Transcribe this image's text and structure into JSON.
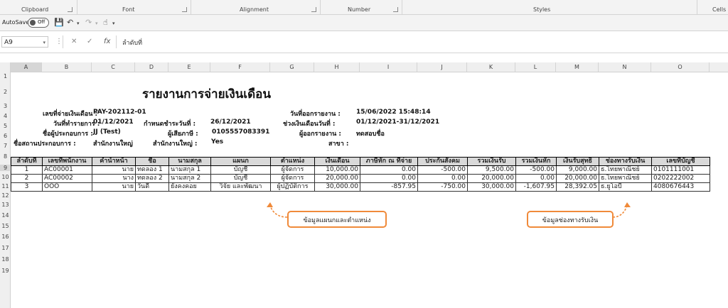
{
  "ribbon": {
    "groups": [
      "Clipboard",
      "Font",
      "Alignment",
      "Number",
      "Styles",
      "Cells"
    ],
    "top_items": [
      "Format Painter",
      "Formatting",
      "Table"
    ]
  },
  "qat": {
    "autosave_label": "AutoSave",
    "autosave_state": "Off"
  },
  "formula_bar": {
    "name_box": "A9",
    "content": "ลำดับที่"
  },
  "columns": [
    "A",
    "B",
    "C",
    "D",
    "E",
    "F",
    "G",
    "H",
    "I",
    "J",
    "K",
    "L",
    "M",
    "N",
    "O"
  ],
  "rows": [
    "1",
    "2",
    "3",
    "4",
    "5",
    "6",
    "7",
    "8",
    "9",
    "10",
    "11",
    "12",
    "13",
    "14",
    "15",
    "16",
    "17",
    "18",
    "19"
  ],
  "report": {
    "title": "รายงานการจ่ายเงินเดือน",
    "pay_no_label": "เลขที่จ่ายเงินเดือน :",
    "pay_no": "PAY-202112-01",
    "issue_date_label": "วันที่ออกรายงาน :",
    "issue_date": "15/06/2022 15:48:14",
    "doc_date_label": "วันที่ทำรายการ :",
    "doc_date": "01/12/2021",
    "due_date_label": "กำหนดชำระวันที่ :",
    "due_date": "26/12/2021",
    "period_label": "ช่วงเงินเดือนวันที่ :",
    "period": "01/12/2021-31/12/2021",
    "company_label": "ชื่อผู้ประกอบการ :",
    "company": "JJ (Test)",
    "taxid_label": "ผู้เสียภาษี :",
    "taxid": "0105557083391",
    "reporter_label": "ผู้ออกรายงาน :",
    "reporter": "ทดสอบชื่อ",
    "branch_name_label": "ชื่อสถานประกอบการ :",
    "branch_name": "สำนักงานใหญ่",
    "head_office_label": "สำนักงานใหญ่ :",
    "head_office": "Yes",
    "branch_label": "สาขา :"
  },
  "table": {
    "headers": [
      "ลำดับที่",
      "เลขที่พนักงาน",
      "คำนำหน้า",
      "ชื่อ",
      "นามสกุล",
      "แผนก",
      "ตำแหน่ง",
      "เงินเดือน",
      "ภาษีหัก ณ ที่จ่าย",
      "ประกันสังคม",
      "รวมเงินรับ",
      "รวมเงินหัก",
      "เงินรับสุทธิ",
      "ช่องทางรับเงิน",
      "เลขที่บัญชี"
    ],
    "rows": [
      [
        "1",
        "AC00001",
        "นาย",
        "ทดลอง 1",
        "นามสกุล 1",
        "บัญชี",
        "ผู้จัดการ",
        "10,000.00",
        "0.00",
        "-500.00",
        "9,500.00",
        "-500.00",
        "9,000.00",
        "ธ.ไทยพาณิชย์",
        "0101111001"
      ],
      [
        "2",
        "AC00002",
        "นาง",
        "ทดลอง 2",
        "นามสกุล 2",
        "บัญชี",
        "ผู้จัดการ",
        "20,000.00",
        "0.00",
        "0.00",
        "20,000.00",
        "0.00",
        "20,000.00",
        "ธ.ไทยพาณิชย์",
        "0202222002"
      ],
      [
        "3",
        "OOO",
        "นาย",
        "วันดี",
        "ยังคงคอย",
        "วิจัย และพัฒนา",
        "ผู้ปฏิบัติการ",
        "30,000.00",
        "-857.95",
        "-750.00",
        "30,000.00",
        "-1,607.95",
        "28,392.05",
        "ธ.ยูโอบี",
        "4080676443"
      ]
    ]
  },
  "callouts": {
    "dept_position": "ข้อมูลแผนกและตำแหน่ง",
    "payment_channel": "ข้อมูลช่องทางรับเงิน"
  },
  "colors": {
    "callout_border": "#f08a3a",
    "header_fill": "#d9d9d9"
  }
}
